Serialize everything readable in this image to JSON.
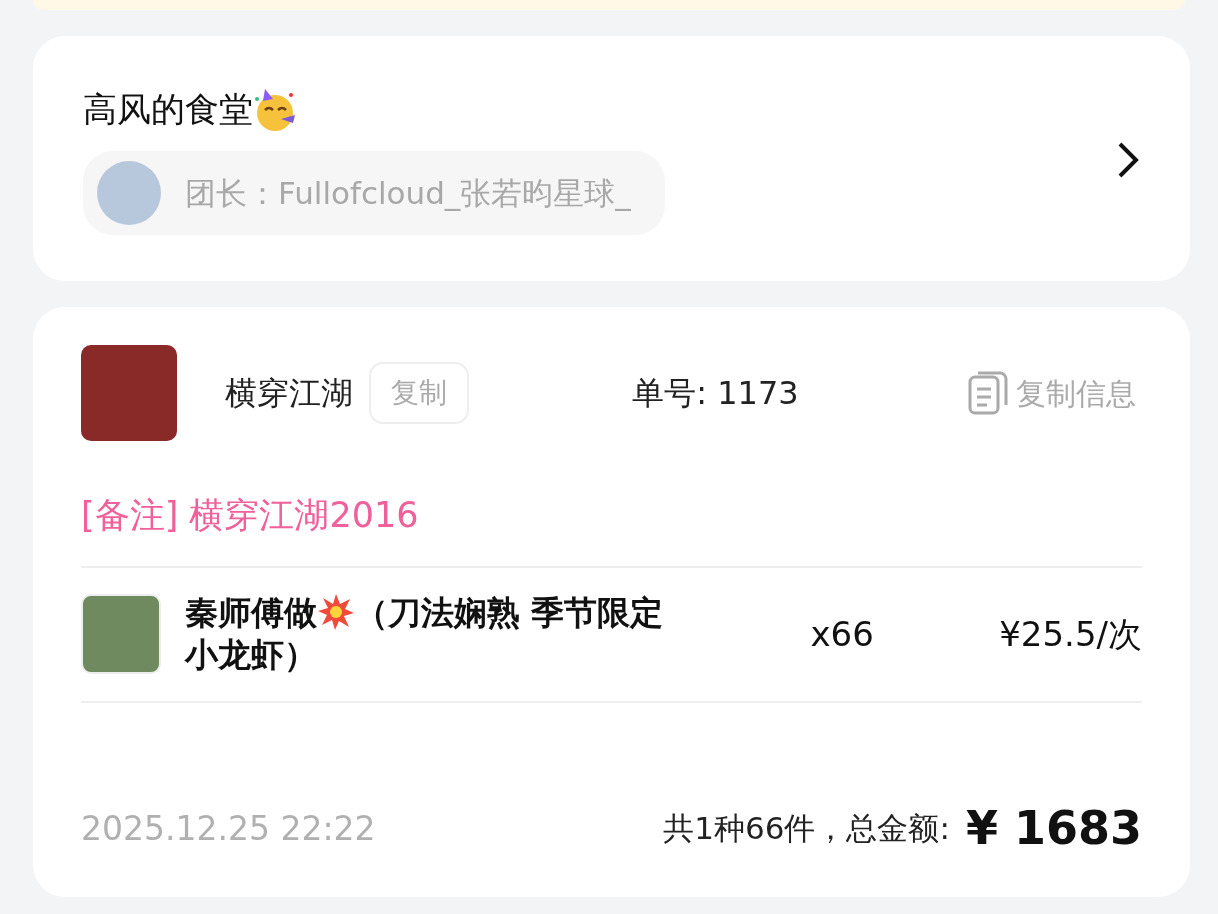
{
  "group": {
    "title": "高风的食堂",
    "leader": "团长：Fullofcloud_张若昀星球_"
  },
  "order": {
    "user": "横穿江湖",
    "copy_button": "复制",
    "order_no": "单号: 1173",
    "copy_info": "复制信息",
    "remark": "[备注] 横穿江湖2016",
    "items": [
      {
        "name": "秦师傅做",
        "detail": "（刀法娴熟 季节限定小龙虾）",
        "qty": "x66",
        "price": "¥25.5/次"
      }
    ],
    "time": "2025.12.25 22:22",
    "summary": "共1种66件，总金额:",
    "total": "¥ 1683"
  }
}
